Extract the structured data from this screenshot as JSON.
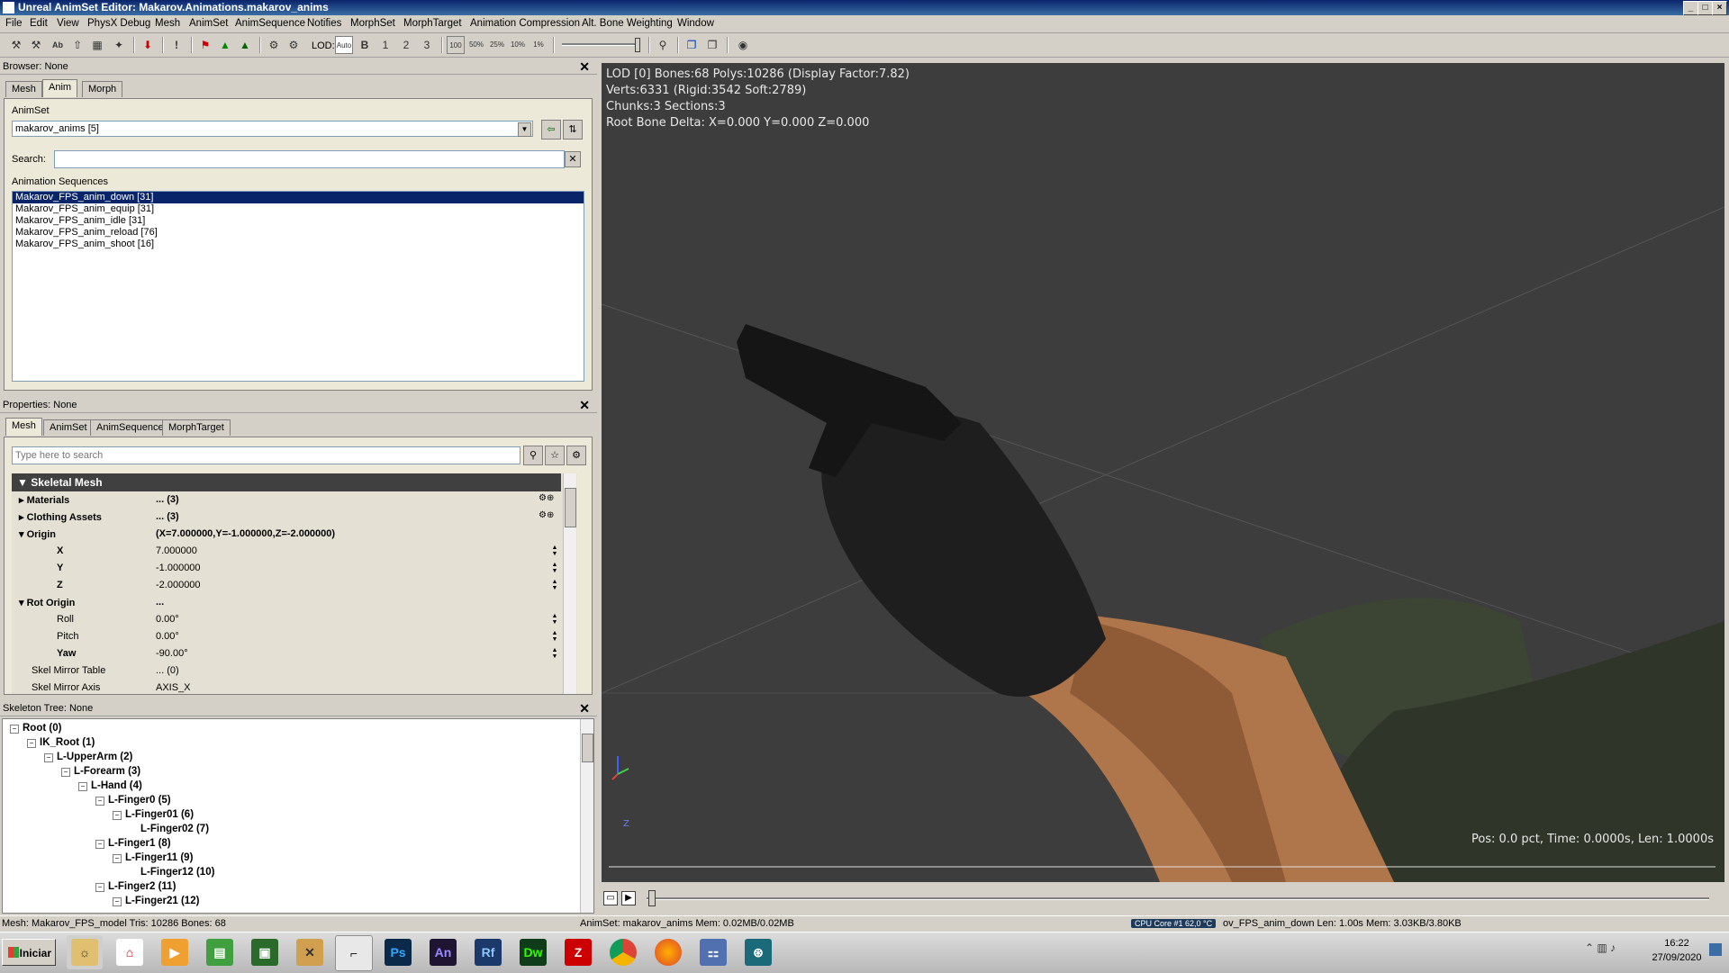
{
  "window": {
    "title": "Unreal AnimSet Editor: Makarov.Animations.makarov_anims",
    "min": "_",
    "max": "□",
    "close": "×"
  },
  "menu": [
    "File",
    "Edit",
    "View",
    "PhysX Debug",
    "Mesh",
    "AnimSet",
    "AnimSequence",
    "Notifies",
    "MorphSet",
    "MorphTarget",
    "Animation Compression",
    "Alt. Bone Weighting",
    "Window"
  ],
  "toolbar": {
    "lod_label": "LOD:",
    "lod_auto": "Auto",
    "lod_b": "B",
    "lod_1": "1",
    "lod_2": "2",
    "lod_3": "3",
    "pct_100": "100",
    "pct_50": "50%",
    "pct_25": "25%",
    "pct_10": "10%",
    "pct_1": "1%"
  },
  "browser": {
    "header": "Browser: None",
    "tabs": [
      "Mesh",
      "Anim",
      "Morph"
    ],
    "active_tab": "Anim",
    "animset_label": "AnimSet",
    "animset_value": "makarov_anims [5]",
    "search_label": "Search:",
    "search_value": "",
    "sequences_label": "Animation Sequences",
    "sequences": [
      "Makarov_FPS_anim_down [31]",
      "Makarov_FPS_anim_equip [31]",
      "Makarov_FPS_anim_idle [31]",
      "Makarov_FPS_anim_reload [76]",
      "Makarov_FPS_anim_shoot [16]"
    ]
  },
  "properties": {
    "header": "Properties: None",
    "tabs": [
      "Mesh",
      "AnimSet",
      "AnimSequence",
      "MorphTarget"
    ],
    "active_tab": "Mesh",
    "search_placeholder": "Type here to search",
    "category": "Skeletal Mesh",
    "rows": {
      "materials": {
        "name": "Materials",
        "value": "... (3)"
      },
      "clothing": {
        "name": "Clothing Assets",
        "value": "... (3)"
      },
      "origin": {
        "name": "Origin",
        "value": "(X=7.000000,Y=-1.000000,Z=-2.000000)"
      },
      "x": {
        "name": "X",
        "value": "7.000000"
      },
      "y": {
        "name": "Y",
        "value": "-1.000000"
      },
      "z": {
        "name": "Z",
        "value": "-2.000000"
      },
      "rot_origin": {
        "name": "Rot Origin",
        "value": "..."
      },
      "roll": {
        "name": "Roll",
        "value": "0.00°"
      },
      "pitch": {
        "name": "Pitch",
        "value": "0.00°"
      },
      "yaw": {
        "name": "Yaw",
        "value": "-90.00°"
      },
      "mirror_table": {
        "name": "Skel Mirror Table",
        "value": "... (0)"
      },
      "mirror_axis": {
        "name": "Skel Mirror Axis",
        "value": "AXIS_X"
      }
    }
  },
  "skeleton": {
    "header": "Skeleton Tree: None",
    "nodes": [
      {
        "label": "Root (0)",
        "depth": 0
      },
      {
        "label": "IK_Root (1)",
        "depth": 1
      },
      {
        "label": "L-UpperArm (2)",
        "depth": 2
      },
      {
        "label": "L-Forearm (3)",
        "depth": 3
      },
      {
        "label": "L-Hand (4)",
        "depth": 4
      },
      {
        "label": "L-Finger0 (5)",
        "depth": 5
      },
      {
        "label": "L-Finger01 (6)",
        "depth": 6
      },
      {
        "label": "L-Finger02 (7)",
        "depth": 7
      },
      {
        "label": "L-Finger1 (8)",
        "depth": 5
      },
      {
        "label": "L-Finger11 (9)",
        "depth": 6
      },
      {
        "label": "L-Finger12 (10)",
        "depth": 7
      },
      {
        "label": "L-Finger2 (11)",
        "depth": 5
      },
      {
        "label": "L-Finger21 (12)",
        "depth": 6
      }
    ]
  },
  "viewport": {
    "line1": "LOD [0] Bones:68 Polys:10286 (Display Factor:7.82)",
    "line2": "Verts:6331 (Rigid:3542 Soft:2789)",
    "line3": "Chunks:3 Sections:3",
    "line4": "Root Bone Delta: X=0.000 Y=0.000 Z=0.000",
    "playback": "Pos: 0.0 pct, Time: 0.0000s, Len: 1.0000s",
    "axis_z": "Z"
  },
  "status": {
    "mesh": "Mesh: Makarov_FPS_model  Tris: 10286  Bones: 68",
    "animset": "AnimSet: makarov_anims  Mem: 0.02MB/0.02MB",
    "cpu": "CPU Core #1    62,0 °C",
    "sequence": "ov_FPS_anim_down  Len: 1.00s  Mem: 3.03KB/3.80KB"
  },
  "taskbar": {
    "start": "Iniciar",
    "apps": [
      {
        "name": "ps",
        "label": "Ps",
        "color": "#0b2a4a",
        "fg": "#31a8ff"
      },
      {
        "name": "an",
        "label": "An",
        "color": "#1f1533",
        "fg": "#9a8cff"
      },
      {
        "name": "rf",
        "label": "Rf",
        "color": "#1b3a6b",
        "fg": "#8ec5ff"
      },
      {
        "name": "dw",
        "label": "Dw",
        "color": "#0f3d1a",
        "fg": "#35fa00"
      }
    ],
    "clock_time": "16:22",
    "clock_date": "27/09/2020"
  }
}
